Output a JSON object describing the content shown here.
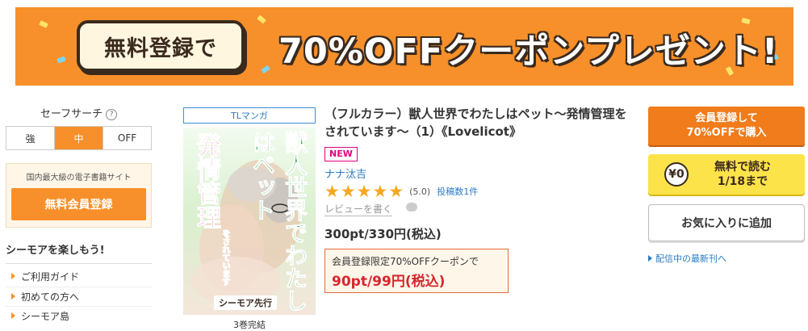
{
  "banner": {
    "pill_text": "無料登録で",
    "headline": "70%OFFクーポンプレゼント!",
    "bg_color": "#f7902a"
  },
  "sidebar": {
    "safe_search_label": "セーフサーチ",
    "help_glyph": "?",
    "safe_options": [
      "強",
      "中",
      "OFF"
    ],
    "safe_selected": "中",
    "register_caption": "国内最大級の電子書籍サイト",
    "register_button": "無料会員登録",
    "enjoy_heading": "シーモアを楽しもう!",
    "links": [
      "ご利用ガイド",
      "初めての方へ",
      "シーモア島"
    ]
  },
  "product": {
    "genre_tag": "TLマンガ",
    "cover": {
      "title_main": "獣人世界でわたしはペット",
      "title_sub": "発情管理",
      "sub_small": "をされています",
      "logo": "シーモア先行"
    },
    "volumes_note": "3巻完結",
    "title": "（フルカラー）獣人世界でわたしはペット～発情管理をされています～（1）《Lovelicot》",
    "new_badge": "NEW",
    "author": "ナナ汰吉",
    "rating_stars": 5,
    "rating_value": "(5.0)",
    "review_count": "投稿数1件",
    "write_review": "レビューを書く",
    "price": "300pt/330円(税込)",
    "coupon_caption": "会員登録限定70%OFFクーポンで",
    "coupon_price": "90pt/99円(税込)"
  },
  "actions": {
    "buy_line1": "会員登録して",
    "buy_line2": "70%OFFで購入",
    "free_icon": "¥0",
    "free_line1": "無料で読む",
    "free_line2": "1/18まで",
    "favorite": "お気に入りに追加",
    "latest_link": "配信中の最新刊へ"
  },
  "colors": {
    "accent_orange": "#f7902a",
    "link_blue": "#2a7bc4",
    "price_red": "#d7262d",
    "star_gold": "#f7a823",
    "free_yellow": "#fde34a"
  }
}
